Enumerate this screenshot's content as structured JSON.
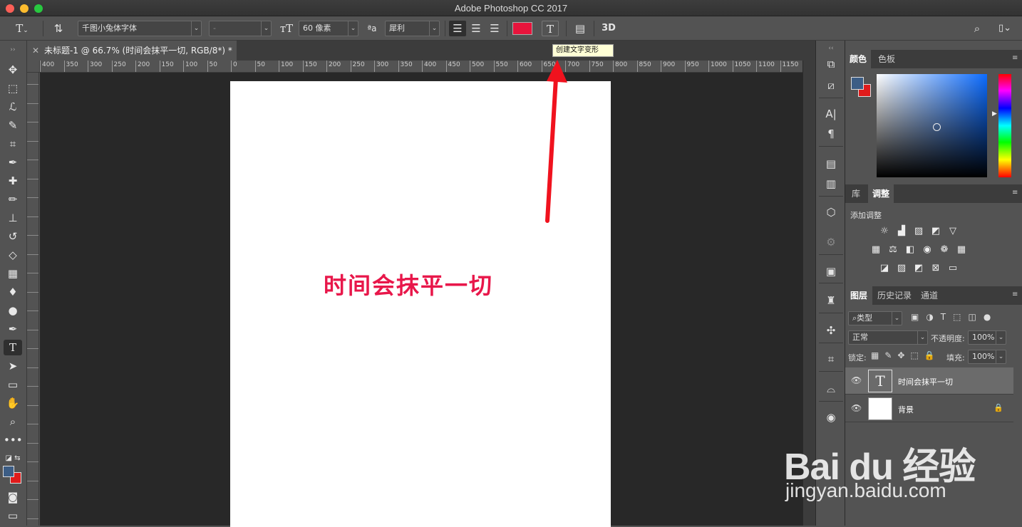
{
  "app": {
    "title": "Adobe Photoshop CC 2017"
  },
  "options": {
    "font_family": "千图小兔体字体",
    "font_style": "-",
    "font_size": "60 像素",
    "antialias_icon_text": "ªa",
    "antialias": "犀利",
    "text_color": "#e8143c",
    "three_d_label": "3D"
  },
  "tooltip": "创建文字变形",
  "document": {
    "tab_title": "未标题-1 @ 66.7% (时间会抹平一切, RGB/8*) *",
    "canvas_text": "时间会抹平一切",
    "text_color": "#e8174a"
  },
  "ruler": {
    "h_ticks": [
      "400",
      "350",
      "300",
      "250",
      "200",
      "150",
      "100",
      "50",
      "0",
      "50",
      "100",
      "150",
      "200",
      "250",
      "300",
      "350",
      "400",
      "450",
      "500",
      "550",
      "600",
      "650",
      "700",
      "750",
      "800",
      "850",
      "900",
      "950",
      "1000",
      "1050",
      "1100",
      "1150"
    ]
  },
  "color_panel": {
    "tabs": [
      "颜色",
      "色板"
    ],
    "foreground": "#3c5d85",
    "background": "#e01b1b"
  },
  "adjust_panel": {
    "tabs": [
      "库",
      "调整"
    ],
    "heading": "添加调整"
  },
  "layers_panel": {
    "tabs": [
      "图层",
      "历史记录",
      "通道"
    ],
    "filter": "类型",
    "blend_mode": "正常",
    "opacity_label": "不透明度:",
    "opacity": "100%",
    "lock_label": "锁定:",
    "fill_label": "填充:",
    "fill": "100%",
    "layers": [
      {
        "name": "时间会抹平一切",
        "thumb": "T",
        "selected": true
      },
      {
        "name": "背景",
        "thumb": "",
        "selected": false
      }
    ]
  },
  "watermark": {
    "brand": "Bai du 经验",
    "url": "jingyan.baidu.com"
  }
}
